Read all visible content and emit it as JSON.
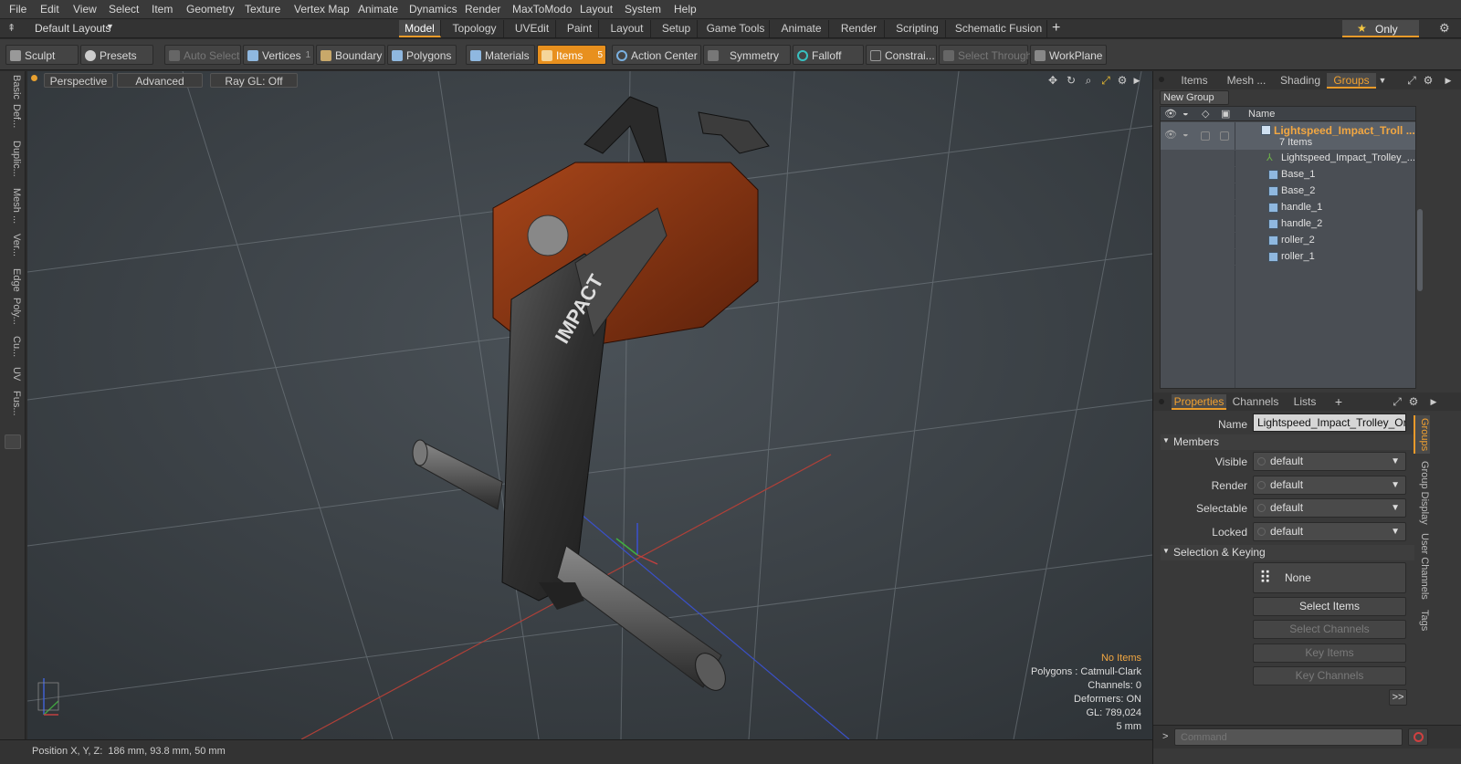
{
  "menu": [
    "File",
    "Edit",
    "View",
    "Select",
    "Item",
    "Geometry",
    "Texture",
    "Vertex Map",
    "Animate",
    "Dynamics",
    "Render",
    "MaxToModo",
    "Layout",
    "System",
    "Help"
  ],
  "layout_selector": "Default Layouts",
  "tabs": [
    "Model",
    "Topology",
    "UVEdit",
    "Paint",
    "Layout",
    "Setup",
    "Game Tools",
    "Animate",
    "Render",
    "Scripting",
    "Schematic Fusion"
  ],
  "only_label": "Only",
  "toolbar": {
    "sculpt": "Sculpt",
    "presets": "Presets",
    "auto_select": "Auto Select",
    "vertices": "Vertices",
    "vertices_count": "1",
    "boundary": "Boundary",
    "polygons": "Polygons",
    "materials": "Materials",
    "items": "Items",
    "items_count": "5",
    "action_center": "Action Center",
    "symmetry": "Symmetry",
    "falloff": "Falloff",
    "constraints": "Constrai...",
    "select_through": "Select Through",
    "workplane": "WorkPlane"
  },
  "left_tabs": [
    "Basic",
    "Def...",
    "Duplic...",
    "Mesh ...",
    "Ver...",
    "Edge",
    "Poly...",
    "Cu...",
    "UV",
    "Fus..."
  ],
  "viewport": {
    "perspective": "Perspective",
    "advanced": "Advanced",
    "raygl": "Ray GL: Off",
    "info": {
      "no_items": "No Items",
      "polygons": "Polygons : Catmull-Clark",
      "channels": "Channels: 0",
      "deformers": "Deformers: ON",
      "gl": "GL: 789,024",
      "scale": "5 mm"
    }
  },
  "status": {
    "position": "Position X, Y, Z:  186 mm, 93.8 mm, 50 mm"
  },
  "panel_tabs": [
    "Items",
    "Mesh ...",
    "Shading",
    "Groups"
  ],
  "new_group": "New Group",
  "group_header": "Name",
  "group": {
    "name": "Lightspeed_Impact_Troll ...",
    "count": "7 Items"
  },
  "group_items": [
    "Lightspeed_Impact_Trolley_...",
    "Base_1",
    "Base_2",
    "handle_1",
    "handle_2",
    "roller_2",
    "roller_1"
  ],
  "props_tabs": [
    "Properties",
    "Channels",
    "Lists"
  ],
  "props": {
    "name_label": "Name",
    "name_value": "Lightspeed_Impact_Trolley_Orang",
    "members": "Members",
    "visible_label": "Visible",
    "visible": "default",
    "render_label": "Render",
    "render": "default",
    "selectable_label": "Selectable",
    "selectable": "default",
    "locked_label": "Locked",
    "locked": "default",
    "sel_keying": "Selection & Keying",
    "none": "None",
    "select_items": "Select Items",
    "select_channels": "Select Channels",
    "key_items": "Key Items",
    "key_channels": "Key Channels",
    "more": ">>"
  },
  "side_tabs": [
    "Groups",
    "Group Display",
    "User Channels",
    "Tags"
  ],
  "command_placeholder": "Command",
  "colors": {
    "accent": "#e89a2a",
    "group_name": "#f2a742",
    "model_orange": "#8a3410"
  }
}
